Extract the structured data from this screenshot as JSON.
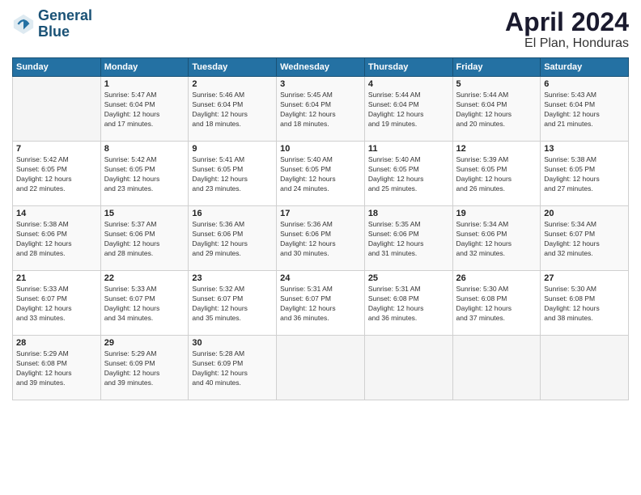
{
  "logo": {
    "line1": "General",
    "line2": "Blue"
  },
  "title": "April 2024",
  "subtitle": "El Plan, Honduras",
  "header_days": [
    "Sunday",
    "Monday",
    "Tuesday",
    "Wednesday",
    "Thursday",
    "Friday",
    "Saturday"
  ],
  "weeks": [
    [
      {
        "day": "",
        "info": ""
      },
      {
        "day": "1",
        "info": "Sunrise: 5:47 AM\nSunset: 6:04 PM\nDaylight: 12 hours\nand 17 minutes."
      },
      {
        "day": "2",
        "info": "Sunrise: 5:46 AM\nSunset: 6:04 PM\nDaylight: 12 hours\nand 18 minutes."
      },
      {
        "day": "3",
        "info": "Sunrise: 5:45 AM\nSunset: 6:04 PM\nDaylight: 12 hours\nand 18 minutes."
      },
      {
        "day": "4",
        "info": "Sunrise: 5:44 AM\nSunset: 6:04 PM\nDaylight: 12 hours\nand 19 minutes."
      },
      {
        "day": "5",
        "info": "Sunrise: 5:44 AM\nSunset: 6:04 PM\nDaylight: 12 hours\nand 20 minutes."
      },
      {
        "day": "6",
        "info": "Sunrise: 5:43 AM\nSunset: 6:04 PM\nDaylight: 12 hours\nand 21 minutes."
      }
    ],
    [
      {
        "day": "7",
        "info": "Sunrise: 5:42 AM\nSunset: 6:05 PM\nDaylight: 12 hours\nand 22 minutes."
      },
      {
        "day": "8",
        "info": "Sunrise: 5:42 AM\nSunset: 6:05 PM\nDaylight: 12 hours\nand 23 minutes."
      },
      {
        "day": "9",
        "info": "Sunrise: 5:41 AM\nSunset: 6:05 PM\nDaylight: 12 hours\nand 23 minutes."
      },
      {
        "day": "10",
        "info": "Sunrise: 5:40 AM\nSunset: 6:05 PM\nDaylight: 12 hours\nand 24 minutes."
      },
      {
        "day": "11",
        "info": "Sunrise: 5:40 AM\nSunset: 6:05 PM\nDaylight: 12 hours\nand 25 minutes."
      },
      {
        "day": "12",
        "info": "Sunrise: 5:39 AM\nSunset: 6:05 PM\nDaylight: 12 hours\nand 26 minutes."
      },
      {
        "day": "13",
        "info": "Sunrise: 5:38 AM\nSunset: 6:05 PM\nDaylight: 12 hours\nand 27 minutes."
      }
    ],
    [
      {
        "day": "14",
        "info": "Sunrise: 5:38 AM\nSunset: 6:06 PM\nDaylight: 12 hours\nand 28 minutes."
      },
      {
        "day": "15",
        "info": "Sunrise: 5:37 AM\nSunset: 6:06 PM\nDaylight: 12 hours\nand 28 minutes."
      },
      {
        "day": "16",
        "info": "Sunrise: 5:36 AM\nSunset: 6:06 PM\nDaylight: 12 hours\nand 29 minutes."
      },
      {
        "day": "17",
        "info": "Sunrise: 5:36 AM\nSunset: 6:06 PM\nDaylight: 12 hours\nand 30 minutes."
      },
      {
        "day": "18",
        "info": "Sunrise: 5:35 AM\nSunset: 6:06 PM\nDaylight: 12 hours\nand 31 minutes."
      },
      {
        "day": "19",
        "info": "Sunrise: 5:34 AM\nSunset: 6:06 PM\nDaylight: 12 hours\nand 32 minutes."
      },
      {
        "day": "20",
        "info": "Sunrise: 5:34 AM\nSunset: 6:07 PM\nDaylight: 12 hours\nand 32 minutes."
      }
    ],
    [
      {
        "day": "21",
        "info": "Sunrise: 5:33 AM\nSunset: 6:07 PM\nDaylight: 12 hours\nand 33 minutes."
      },
      {
        "day": "22",
        "info": "Sunrise: 5:33 AM\nSunset: 6:07 PM\nDaylight: 12 hours\nand 34 minutes."
      },
      {
        "day": "23",
        "info": "Sunrise: 5:32 AM\nSunset: 6:07 PM\nDaylight: 12 hours\nand 35 minutes."
      },
      {
        "day": "24",
        "info": "Sunrise: 5:31 AM\nSunset: 6:07 PM\nDaylight: 12 hours\nand 36 minutes."
      },
      {
        "day": "25",
        "info": "Sunrise: 5:31 AM\nSunset: 6:08 PM\nDaylight: 12 hours\nand 36 minutes."
      },
      {
        "day": "26",
        "info": "Sunrise: 5:30 AM\nSunset: 6:08 PM\nDaylight: 12 hours\nand 37 minutes."
      },
      {
        "day": "27",
        "info": "Sunrise: 5:30 AM\nSunset: 6:08 PM\nDaylight: 12 hours\nand 38 minutes."
      }
    ],
    [
      {
        "day": "28",
        "info": "Sunrise: 5:29 AM\nSunset: 6:08 PM\nDaylight: 12 hours\nand 39 minutes."
      },
      {
        "day": "29",
        "info": "Sunrise: 5:29 AM\nSunset: 6:09 PM\nDaylight: 12 hours\nand 39 minutes."
      },
      {
        "day": "30",
        "info": "Sunrise: 5:28 AM\nSunset: 6:09 PM\nDaylight: 12 hours\nand 40 minutes."
      },
      {
        "day": "",
        "info": ""
      },
      {
        "day": "",
        "info": ""
      },
      {
        "day": "",
        "info": ""
      },
      {
        "day": "",
        "info": ""
      }
    ]
  ]
}
